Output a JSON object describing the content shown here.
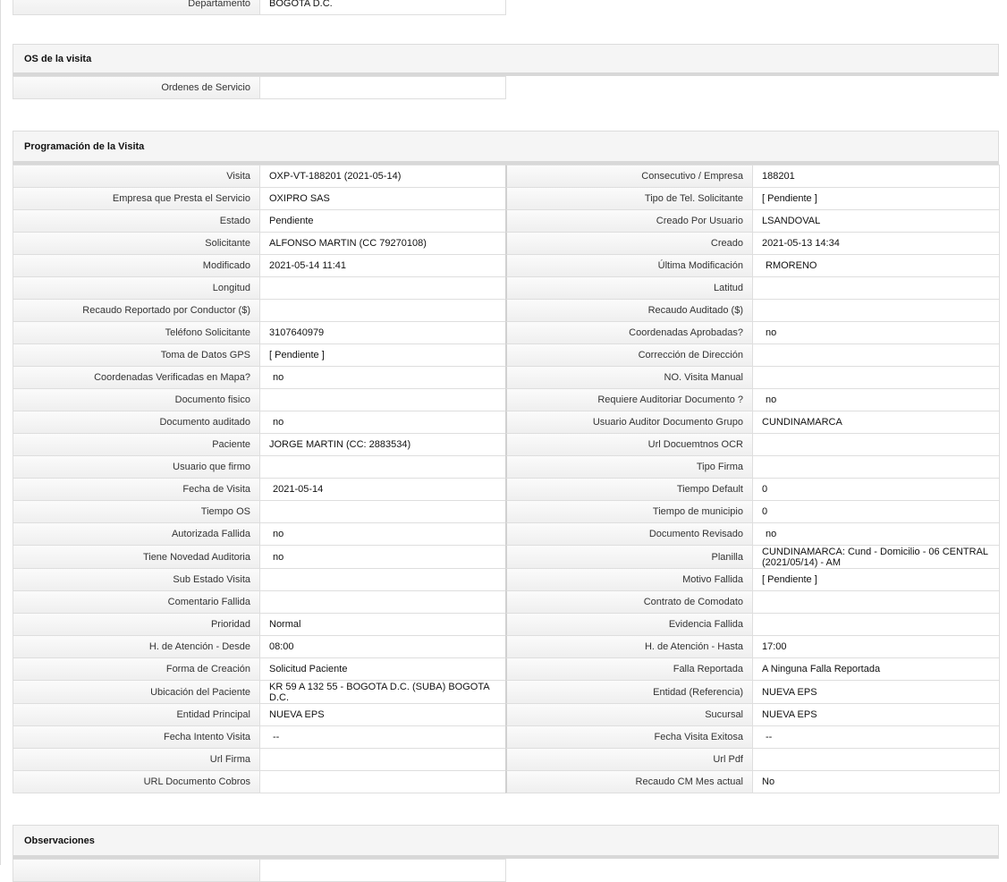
{
  "top_row": {
    "label": "Departamento",
    "value": "BOGOTA D.C."
  },
  "os_section": {
    "title": "OS de la visita",
    "rows": [
      {
        "label": "Ordenes de Servicio",
        "value": ""
      }
    ]
  },
  "programacion": {
    "title": "Programación de la Visita",
    "rows": [
      {
        "l1": "Visita",
        "v1": "OXP-VT-188201 (2021-05-14)",
        "l2": "Consecutivo / Empresa",
        "v2": "188201"
      },
      {
        "l1": "Empresa que Presta el Servicio",
        "v1": "OXIPRO SAS",
        "l2": "Tipo de Tel. Solicitante",
        "v2": "[ Pendiente ]"
      },
      {
        "l1": "Estado",
        "v1": "Pendiente",
        "l2": "Creado Por Usuario",
        "v2": "LSANDOVAL"
      },
      {
        "l1": "Solicitante",
        "v1": "ALFONSO MARTIN (CC 79270108)",
        "l2": "Creado",
        "v2": "2021-05-13 14:34"
      },
      {
        "l1": "Modificado",
        "v1": "2021-05-14 11:41",
        "l2": "Última Modificación",
        "v2": "RMORENO"
      },
      {
        "l1": "Longitud",
        "v1": "",
        "l2": "Latitud",
        "v2": ""
      },
      {
        "l1": "Recaudo Reportado por Conductor ($)",
        "v1": "",
        "l2": "Recaudo Auditado ($)",
        "v2": ""
      },
      {
        "l1": "Teléfono Solicitante",
        "v1": "3107640979",
        "l2": "Coordenadas Aprobadas?",
        "v2": "no"
      },
      {
        "l1": "Toma de Datos GPS",
        "v1": "[ Pendiente ]",
        "l2": "Corrección de Dirección",
        "v2": ""
      },
      {
        "l1": "Coordenadas Verificadas en Mapa?",
        "v1": "no",
        "l2": "NO. Visita Manual",
        "v2": ""
      },
      {
        "l1": "Documento fisico",
        "v1": "",
        "l2": "Requiere Auditoriar Documento ?",
        "v2": "no"
      },
      {
        "l1": "Documento auditado",
        "v1": "no",
        "l2": "Usuario Auditor Documento Grupo",
        "v2": "CUNDINAMARCA"
      },
      {
        "l1": "Paciente",
        "v1": "JORGE MARTIN (CC: 2883534)",
        "l2": "Url Docuemtnos OCR",
        "v2": ""
      },
      {
        "l1": "Usuario que firmo",
        "v1": "",
        "l2": "Tipo Firma",
        "v2": ""
      },
      {
        "l1": "Fecha de Visita",
        "v1": "2021-05-14",
        "l2": "Tiempo Default",
        "v2": "0"
      },
      {
        "l1": "Tiempo OS",
        "v1": "",
        "l2": "Tiempo de municipio",
        "v2": "0"
      },
      {
        "l1": "Autorizada Fallida",
        "v1": "no",
        "l2": "Documento Revisado",
        "v2": "no"
      },
      {
        "l1": "Tiene Novedad Auditoria",
        "v1": "no",
        "l2": "Planilla",
        "v2": "CUNDINAMARCA: Cund - Domicilio - 06 CENTRAL (2021/05/14) - AM"
      },
      {
        "l1": "Sub Estado Visita",
        "v1": "",
        "l2": "Motivo Fallida",
        "v2": "[ Pendiente ]"
      },
      {
        "l1": "Comentario Fallida",
        "v1": "",
        "l2": "Contrato de Comodato",
        "v2": ""
      },
      {
        "l1": "Prioridad",
        "v1": "Normal",
        "l2": "Evidencia Fallida",
        "v2": ""
      },
      {
        "l1": "H. de Atención - Desde",
        "v1": "08:00",
        "l2": "H. de Atención - Hasta",
        "v2": "17:00"
      },
      {
        "l1": "Forma de Creación",
        "v1": "Solicitud Paciente",
        "l2": "Falla Reportada",
        "v2": "A Ninguna Falla Reportada"
      },
      {
        "l1": "Ubicación del Paciente",
        "v1": "KR 59 A 132 55 - BOGOTA D.C. (SUBA) BOGOTA D.C.",
        "l2": "Entidad (Referencia)",
        "v2": "NUEVA EPS"
      },
      {
        "l1": "Entidad Principal",
        "v1": "NUEVA EPS",
        "l2": "Sucursal",
        "v2": "NUEVA EPS"
      },
      {
        "l1": "Fecha Intento Visita",
        "v1": "--",
        "l2": "Fecha Visita Exitosa",
        "v2": "--"
      },
      {
        "l1": "Url Firma",
        "v1": "",
        "l2": "Url Pdf",
        "v2": ""
      },
      {
        "l1": "URL Documento Cobros",
        "v1": "",
        "l2": "Recaudo CM Mes actual",
        "v2": "No"
      }
    ]
  },
  "observaciones": {
    "title": "Observaciones"
  }
}
